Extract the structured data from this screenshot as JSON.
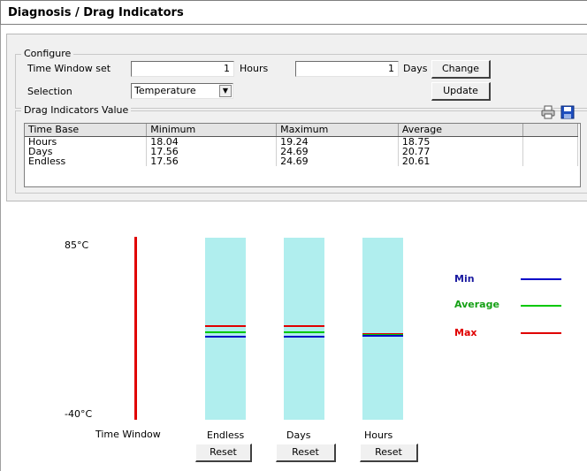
{
  "header": {
    "title": "Diagnosis / Drag Indicators"
  },
  "configure": {
    "legend": "Configure",
    "time_window_label": "Time Window set",
    "hours_value": "1",
    "hours_unit": "Hours",
    "days_value": "1",
    "days_unit": "Days",
    "change_label": "Change",
    "selection_label": "Selection",
    "selection_value": "Temperature",
    "update_label": "Update"
  },
  "drag_values": {
    "legend": "Drag Indicators Value",
    "columns": [
      "Time Base",
      "Minimum",
      "Maximum",
      "Average"
    ],
    "rows": [
      [
        "Hours",
        "18.04",
        "19.24",
        "18.75"
      ],
      [
        "Days",
        "17.56",
        "24.69",
        "20.77"
      ],
      [
        "Endless",
        "17.56",
        "24.69",
        "20.61"
      ]
    ]
  },
  "chart": {
    "top_label": "85°C",
    "bottom_label": "-40°C",
    "time_window_label": "Time Window",
    "range_min": -40,
    "range_max": 85,
    "bars": [
      {
        "name": "Endless",
        "min": 17.56,
        "max": 24.69,
        "avg": 20.61,
        "reset": "Reset"
      },
      {
        "name": "Days",
        "min": 17.56,
        "max": 24.69,
        "avg": 20.77,
        "reset": "Reset"
      },
      {
        "name": "Hours",
        "min": 18.04,
        "max": 19.24,
        "avg": 18.75,
        "reset": "Reset"
      }
    ],
    "legend": [
      {
        "label": "Min",
        "color": "#0000c8"
      },
      {
        "label": "Average",
        "color": "#00c800"
      },
      {
        "label": "Max",
        "color": "#e00000"
      }
    ],
    "axis_color": "#e00000",
    "bar_color": "#b0eeee"
  }
}
